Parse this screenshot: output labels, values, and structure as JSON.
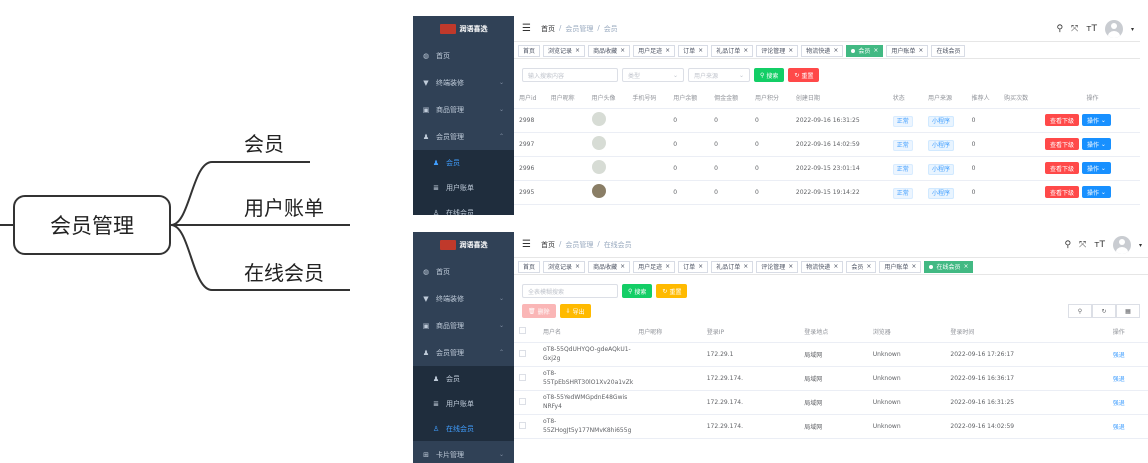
{
  "mindmap": {
    "root": "会员管理",
    "children": [
      "会员",
      "用户账单",
      "在线会员"
    ]
  },
  "sidebar": {
    "logo": "润语喜选",
    "items": [
      {
        "icon": "dashboard-icon",
        "label": "首页"
      },
      {
        "icon": "shirt-icon",
        "label": "终端装修"
      },
      {
        "icon": "box-icon",
        "label": "商品管理"
      },
      {
        "icon": "users-icon",
        "label": "会员管理"
      }
    ],
    "subitems": [
      {
        "icon": "user-icon",
        "label": "会员"
      },
      {
        "icon": "list-icon",
        "label": "用户账单"
      },
      {
        "icon": "online-user-icon",
        "label": "在线会员"
      }
    ],
    "extra": {
      "icon": "card-icon",
      "label": "卡片管理"
    }
  },
  "panel1": {
    "breadcrumb": [
      "首页",
      "会员管理",
      "会员"
    ],
    "tags": [
      "首页",
      "浏览记录",
      "商品收藏",
      "用户足迹",
      "订单",
      "礼品订单",
      "评论管理",
      "物流快递",
      "会员",
      "用户账单",
      "在线会员"
    ],
    "active_tag": "会员",
    "filters": {
      "search_placeholder": "输入搜索内容",
      "type_placeholder": "类型",
      "source_placeholder": "用户来源",
      "search_btn": "搜索",
      "reset_btn": "重置"
    },
    "columns": [
      "用户id",
      "用户昵称",
      "用户头像",
      "手机号码",
      "用户余额",
      "佣金金额",
      "用户积分",
      "创建日期",
      "状态",
      "用户来源",
      "推荐人",
      "购买次数",
      "操作"
    ],
    "rows": [
      {
        "id": "2998",
        "balance": "0",
        "commission": "0",
        "points": "0",
        "created": "2022-09-16 16:31:25",
        "status": "正常",
        "source": "小程序",
        "referrer": "0"
      },
      {
        "id": "2997",
        "balance": "0",
        "commission": "0",
        "points": "0",
        "created": "2022-09-16 14:02:59",
        "status": "正常",
        "source": "小程序",
        "referrer": "0"
      },
      {
        "id": "2996",
        "balance": "0",
        "commission": "0",
        "points": "0",
        "created": "2022-09-15 23:01:14",
        "status": "正常",
        "source": "小程序",
        "referrer": "0"
      },
      {
        "id": "2995",
        "balance": "0",
        "commission": "0",
        "points": "0",
        "created": "2022-09-15 19:14:22",
        "status": "正常",
        "source": "小程序",
        "referrer": "0"
      }
    ],
    "op_view": "查看下级",
    "op_more": "操作"
  },
  "panel2": {
    "breadcrumb": [
      "首页",
      "会员管理",
      "在线会员"
    ],
    "tags": [
      "首页",
      "浏览记录",
      "商品收藏",
      "用户足迹",
      "订单",
      "礼品订单",
      "评论管理",
      "物流快递",
      "会员",
      "用户账单",
      "在线会员"
    ],
    "active_tag": "在线会员",
    "filters": {
      "search_placeholder": "全表模糊搜索",
      "search_btn": "搜索",
      "reset_btn": "重置",
      "delete_btn": "删除",
      "export_btn": "导出"
    },
    "columns": [
      "用户名",
      "用户昵称",
      "登录IP",
      "登录地点",
      "浏览器",
      "登录时间",
      "操作"
    ],
    "rows": [
      {
        "user": "oT8-55QdUHYQO-gdeAQkU1-Gxj2g",
        "ip": "172.29.1",
        "loc": "局域网",
        "browser": "Unknown",
        "time": "2022-09-16 17:26:17"
      },
      {
        "user": "oT8-55TpEbSHRT30lO1Xv20a1vZk",
        "ip": "172.29.174.",
        "loc": "局域网",
        "browser": "Unknown",
        "time": "2022-09-16 16:36:17"
      },
      {
        "user": "oT8-55YedWMGpdnE48Gwis NRFy4",
        "ip": "172.29.174.",
        "loc": "局域网",
        "browser": "Unknown",
        "time": "2022-09-16 16:31:25"
      },
      {
        "user": "oT8-55ZHogJt5y177NMvK8hi655g",
        "ip": "172.29.174.",
        "loc": "局域网",
        "browser": "Unknown",
        "time": "2022-09-16 14:02:59"
      }
    ],
    "op": "强退"
  }
}
